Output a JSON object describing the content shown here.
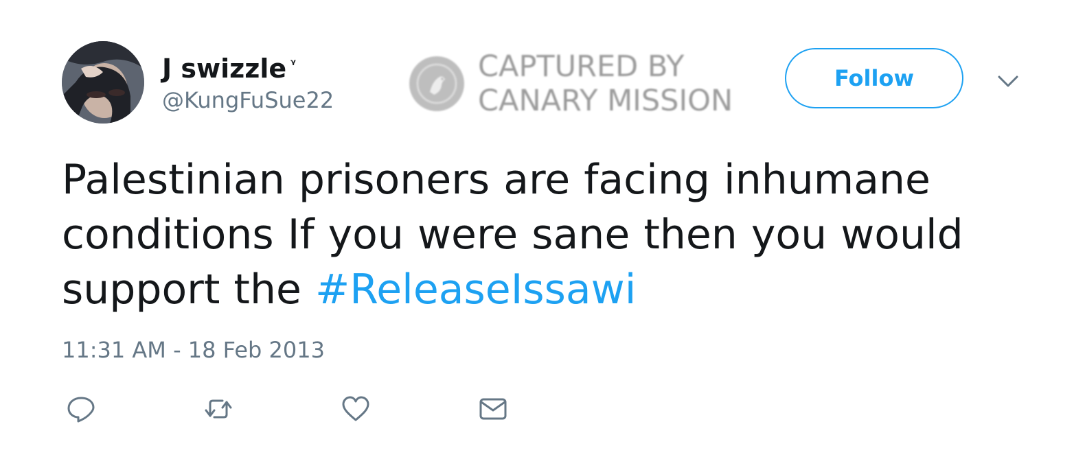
{
  "tweet": {
    "author": {
      "display_name": "J swizzle",
      "name_badge": "ᵞ",
      "handle": "@KungFuSue22",
      "avatar_icon": "user-avatar-photo"
    },
    "watermark": {
      "line1": "CAPTURED BY",
      "line2": "CANARY MISSION",
      "logo_icon": "canary-bird-icon"
    },
    "follow_label": "Follow",
    "menu_icon": "chevron-down-icon",
    "text_line1": "Palestinian prisoners are facing inhumane",
    "text_line2": "conditions If you were sane then you would",
    "text_line3_prefix": "support the ",
    "hashtag": "#ReleaseIssawi",
    "timestamp": "11:31 AM - 18 Feb 2013",
    "actions": [
      {
        "name": "reply",
        "icon": "reply-icon"
      },
      {
        "name": "retweet",
        "icon": "retweet-icon"
      },
      {
        "name": "like",
        "icon": "heart-icon"
      },
      {
        "name": "direct-message",
        "icon": "envelope-icon"
      }
    ]
  },
  "colors": {
    "accent": "#1da1f2",
    "text": "#14171a",
    "secondary": "#657786"
  }
}
